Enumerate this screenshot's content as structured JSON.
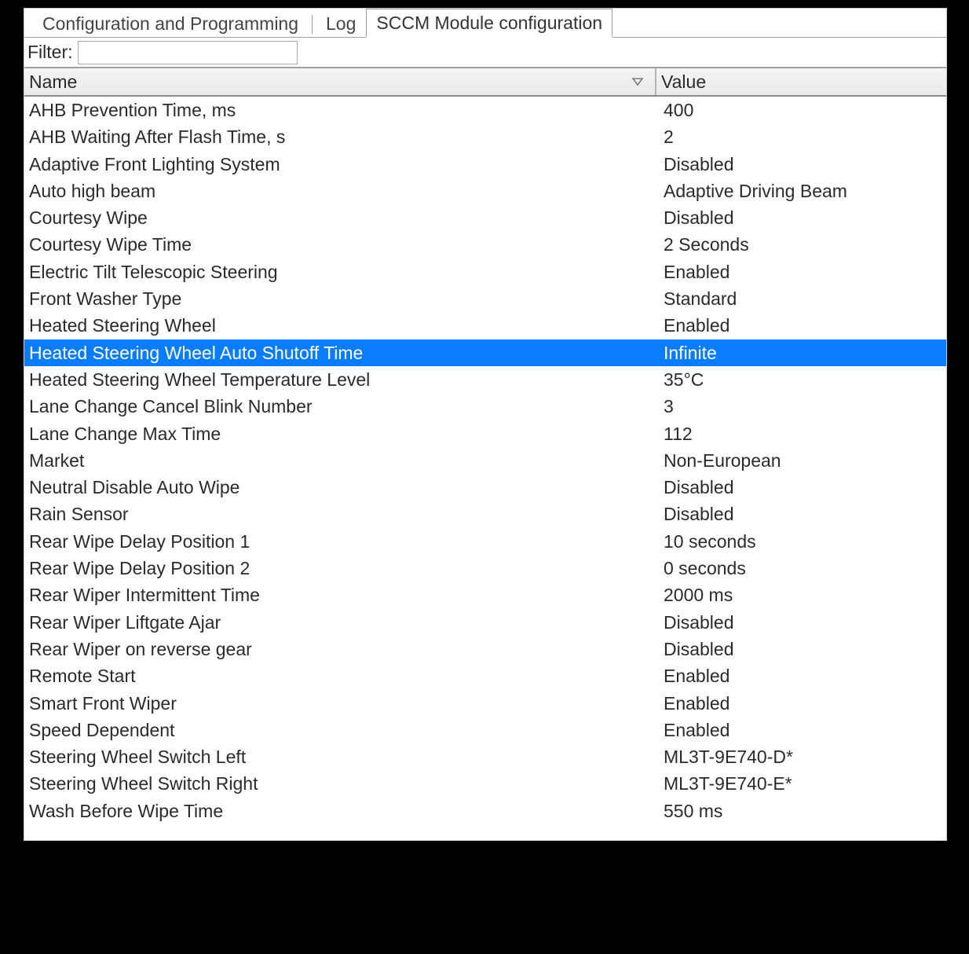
{
  "tabs": [
    {
      "id": "cfg",
      "label": "Configuration and Programming",
      "active": false
    },
    {
      "id": "log",
      "label": "Log",
      "active": false
    },
    {
      "id": "sccm",
      "label": "SCCM Module configuration",
      "active": true
    }
  ],
  "filter": {
    "label": "Filter:",
    "value": ""
  },
  "columns": {
    "name": "Name",
    "value": "Value",
    "sort_on_name": "desc"
  },
  "selected_index": 9,
  "rows": [
    {
      "name": "AHB Prevention Time, ms",
      "value": "400"
    },
    {
      "name": "AHB Waiting After Flash Time, s",
      "value": "2"
    },
    {
      "name": "Adaptive Front Lighting System",
      "value": "Disabled"
    },
    {
      "name": "Auto high beam",
      "value": "Adaptive Driving Beam"
    },
    {
      "name": "Courtesy Wipe",
      "value": "Disabled"
    },
    {
      "name": "Courtesy Wipe Time",
      "value": "2 Seconds"
    },
    {
      "name": "Electric Tilt Telescopic Steering",
      "value": "Enabled"
    },
    {
      "name": "Front Washer Type",
      "value": "Standard"
    },
    {
      "name": "Heated Steering Wheel",
      "value": "Enabled"
    },
    {
      "name": "Heated Steering Wheel Auto Shutoff Time",
      "value": "Infinite"
    },
    {
      "name": "Heated Steering Wheel Temperature Level",
      "value": "35°C"
    },
    {
      "name": "Lane Change Cancel Blink Number",
      "value": "3"
    },
    {
      "name": "Lane Change Max Time",
      "value": "112"
    },
    {
      "name": "Market",
      "value": "Non-European"
    },
    {
      "name": "Neutral Disable Auto Wipe",
      "value": "Disabled"
    },
    {
      "name": "Rain Sensor",
      "value": "Disabled"
    },
    {
      "name": "Rear Wipe Delay Position 1",
      "value": "10 seconds"
    },
    {
      "name": "Rear Wipe Delay Position 2",
      "value": "0 seconds"
    },
    {
      "name": "Rear Wiper Intermittent Time",
      "value": "2000 ms"
    },
    {
      "name": "Rear Wiper Liftgate Ajar",
      "value": "Disabled"
    },
    {
      "name": "Rear Wiper on reverse gear",
      "value": "Disabled"
    },
    {
      "name": "Remote Start",
      "value": "Enabled"
    },
    {
      "name": "Smart Front Wiper",
      "value": "Enabled"
    },
    {
      "name": "Speed Dependent",
      "value": "Enabled"
    },
    {
      "name": "Steering Wheel Switch Left",
      "value": "ML3T-9E740-D*"
    },
    {
      "name": "Steering Wheel Switch Right",
      "value": "ML3T-9E740-E*"
    },
    {
      "name": "Wash Before Wipe Time",
      "value": "550 ms"
    }
  ]
}
